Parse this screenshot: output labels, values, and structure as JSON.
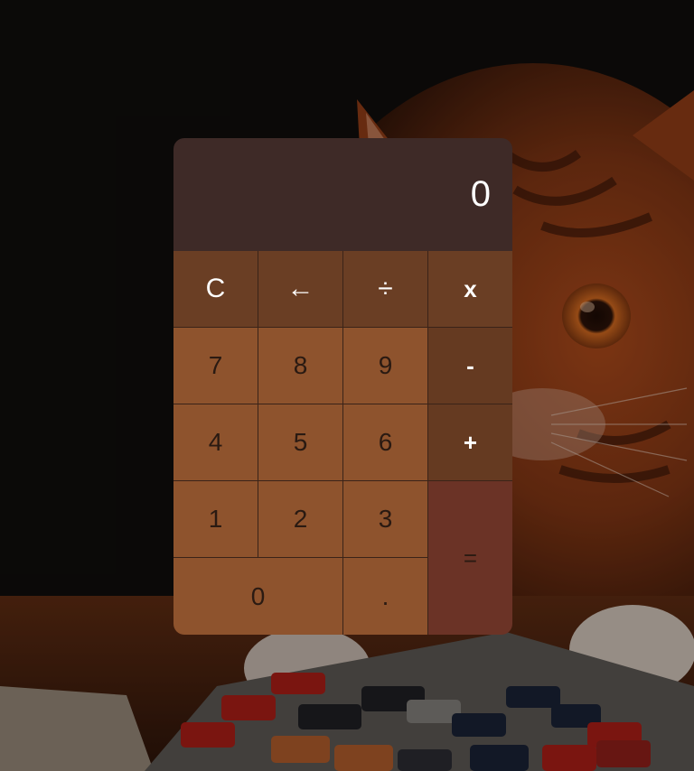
{
  "display": {
    "value": "0"
  },
  "keys": {
    "clear": "C",
    "backspace": "←",
    "divide": "÷",
    "multiply": "x",
    "seven": "7",
    "eight": "8",
    "nine": "9",
    "subtract": "-",
    "four": "4",
    "five": "5",
    "six": "6",
    "add": "+",
    "one": "1",
    "two": "2",
    "three": "3",
    "equals": "=",
    "zero": "0",
    "decimal": "."
  },
  "colors": {
    "display_bg": "#3e2a27",
    "function_key_bg": "#6a3e24",
    "digit_key_bg": "#8e532d",
    "operator_key_bg": "#653a21",
    "equals_key_bg": "#6b3326"
  }
}
